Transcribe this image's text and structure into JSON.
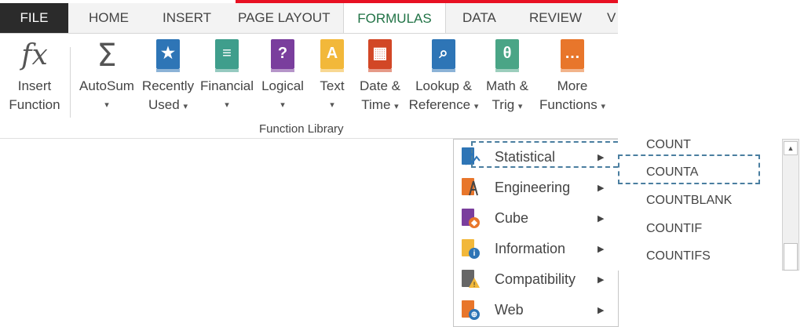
{
  "tabs": {
    "file": "FILE",
    "items": [
      "HOME",
      "INSERT",
      "PAGE LAYOUT"
    ],
    "active": "FORMULAS",
    "after": [
      "DATA",
      "REVIEW",
      "V"
    ]
  },
  "ribbon": {
    "insert_function": {
      "line1": "Insert",
      "line2": "Function",
      "icon": "fx"
    },
    "autosum": {
      "line1": "AutoSum",
      "caret": "▾",
      "icon": "Σ"
    },
    "recently_used": {
      "line1": "Recently",
      "line2": "Used",
      "caret": "▾",
      "icon": "★"
    },
    "financial": {
      "line1": "Financial",
      "caret": "▾",
      "icon": "≡"
    },
    "logical": {
      "line1": "Logical",
      "caret": "▾",
      "icon": "?"
    },
    "text": {
      "line1": "Text",
      "caret": "▾",
      "icon": "A"
    },
    "date_time": {
      "line1": "Date &",
      "line2": "Time",
      "caret": "▾",
      "icon": "▦"
    },
    "lookup_reference": {
      "line1": "Lookup &",
      "line2": "Reference",
      "caret": "▾",
      "icon": "⌕"
    },
    "math_trig": {
      "line1": "Math &",
      "line2": "Trig",
      "caret": "▾",
      "icon": "θ"
    },
    "more_functions": {
      "line1": "More",
      "line2": "Functions",
      "caret": "▾",
      "icon": "…"
    },
    "group_label": "Function Library"
  },
  "colors": {
    "blue": "#2e75b6",
    "teal": "#3f9e8c",
    "purple": "#7a3e9d",
    "yellow": "#f2b83a",
    "red": "#d24726",
    "green": "#4aa586",
    "orange": "#e8762b",
    "accent": "#217346"
  },
  "menu": {
    "items": [
      {
        "label": "Statistical",
        "icon": "statistical-icon"
      },
      {
        "label": "Engineering",
        "icon": "engineering-icon"
      },
      {
        "label": "Cube",
        "icon": "cube-icon"
      },
      {
        "label": "Information",
        "icon": "information-icon"
      },
      {
        "label": "Compatibility",
        "icon": "compatibility-icon"
      },
      {
        "label": "Web",
        "icon": "web-icon"
      }
    ],
    "arrow": "▶"
  },
  "submenu": {
    "items": [
      "COUNT",
      "COUNTA",
      "COUNTBLANK",
      "COUNTIF",
      "COUNTIFS"
    ],
    "scroll_up": "▲"
  }
}
